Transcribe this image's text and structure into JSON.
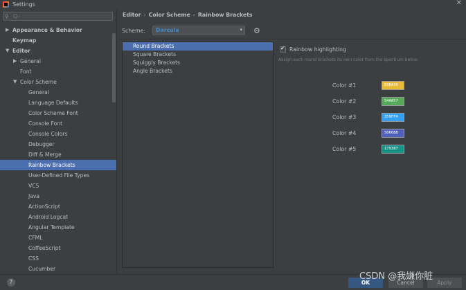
{
  "window": {
    "title": "Settings"
  },
  "sidebar": {
    "search_placeholder": "Q-",
    "items": [
      {
        "label": "Appearance & Behavior",
        "bold": true,
        "arrow": "right",
        "indent": 0
      },
      {
        "label": "Keymap",
        "bold": true,
        "arrow": "",
        "indent": 0
      },
      {
        "label": "Editor",
        "bold": true,
        "arrow": "down",
        "indent": 0
      },
      {
        "label": "General",
        "bold": false,
        "arrow": "right",
        "indent": 1
      },
      {
        "label": "Font",
        "bold": false,
        "arrow": "",
        "indent": 1
      },
      {
        "label": "Color Scheme",
        "bold": false,
        "arrow": "down",
        "indent": 1
      },
      {
        "label": "General",
        "bold": false,
        "arrow": "",
        "indent": 2
      },
      {
        "label": "Language Defaults",
        "bold": false,
        "arrow": "",
        "indent": 2
      },
      {
        "label": "Color Scheme Font",
        "bold": false,
        "arrow": "",
        "indent": 2
      },
      {
        "label": "Console Font",
        "bold": false,
        "arrow": "",
        "indent": 2
      },
      {
        "label": "Console Colors",
        "bold": false,
        "arrow": "",
        "indent": 2
      },
      {
        "label": "Debugger",
        "bold": false,
        "arrow": "",
        "indent": 2
      },
      {
        "label": "Diff & Merge",
        "bold": false,
        "arrow": "",
        "indent": 2
      },
      {
        "label": "Rainbow Brackets",
        "bold": false,
        "arrow": "",
        "indent": 2,
        "selected": true
      },
      {
        "label": "User-Defined File Types",
        "bold": false,
        "arrow": "",
        "indent": 2
      },
      {
        "label": "VCS",
        "bold": false,
        "arrow": "",
        "indent": 2
      },
      {
        "label": "Java",
        "bold": false,
        "arrow": "",
        "indent": 2
      },
      {
        "label": "ActionScript",
        "bold": false,
        "arrow": "",
        "indent": 2
      },
      {
        "label": "Android Logcat",
        "bold": false,
        "arrow": "",
        "indent": 2
      },
      {
        "label": "Angular Template",
        "bold": false,
        "arrow": "",
        "indent": 2
      },
      {
        "label": "CFML",
        "bold": false,
        "arrow": "",
        "indent": 2
      },
      {
        "label": "CoffeeScript",
        "bold": false,
        "arrow": "",
        "indent": 2
      },
      {
        "label": "CSS",
        "bold": false,
        "arrow": "",
        "indent": 2
      },
      {
        "label": "Cucumber",
        "bold": false,
        "arrow": "",
        "indent": 2
      }
    ]
  },
  "breadcrumb": [
    "Editor",
    "Color Scheme",
    "Rainbow Brackets"
  ],
  "scheme": {
    "label": "Scheme:",
    "value": "Darcula"
  },
  "brackets": [
    {
      "label": "Round Brackets",
      "selected": true
    },
    {
      "label": "Square Brackets",
      "selected": false
    },
    {
      "label": "Squiggly Brackets",
      "selected": false
    },
    {
      "label": "Angle Brackets",
      "selected": false
    }
  ],
  "highlight": {
    "checkbox_label": "Rainbow highlighting",
    "checked": true,
    "hint": "Assign each round brackets its own color from the spectrum below:"
  },
  "colors": [
    {
      "label": "Color #1",
      "hex": "#E8BA36",
      "text": "E8BA36"
    },
    {
      "label": "Color #2",
      "hex": "#54A857",
      "text": "54A857"
    },
    {
      "label": "Color #3",
      "hex": "#359FF4",
      "text": "359FF4"
    },
    {
      "label": "Color #4",
      "hex": "#5060BB",
      "text": "5060BB"
    },
    {
      "label": "Color #5",
      "hex": "#179387",
      "text": "179387"
    }
  ],
  "footer": {
    "help": "?",
    "ok": "OK",
    "cancel": "Cancel",
    "apply": "Apply"
  },
  "watermark": "CSDN @我嫌你脏",
  "theme": {
    "selection": "#4b6eaf",
    "accent": "#4a88c7"
  }
}
